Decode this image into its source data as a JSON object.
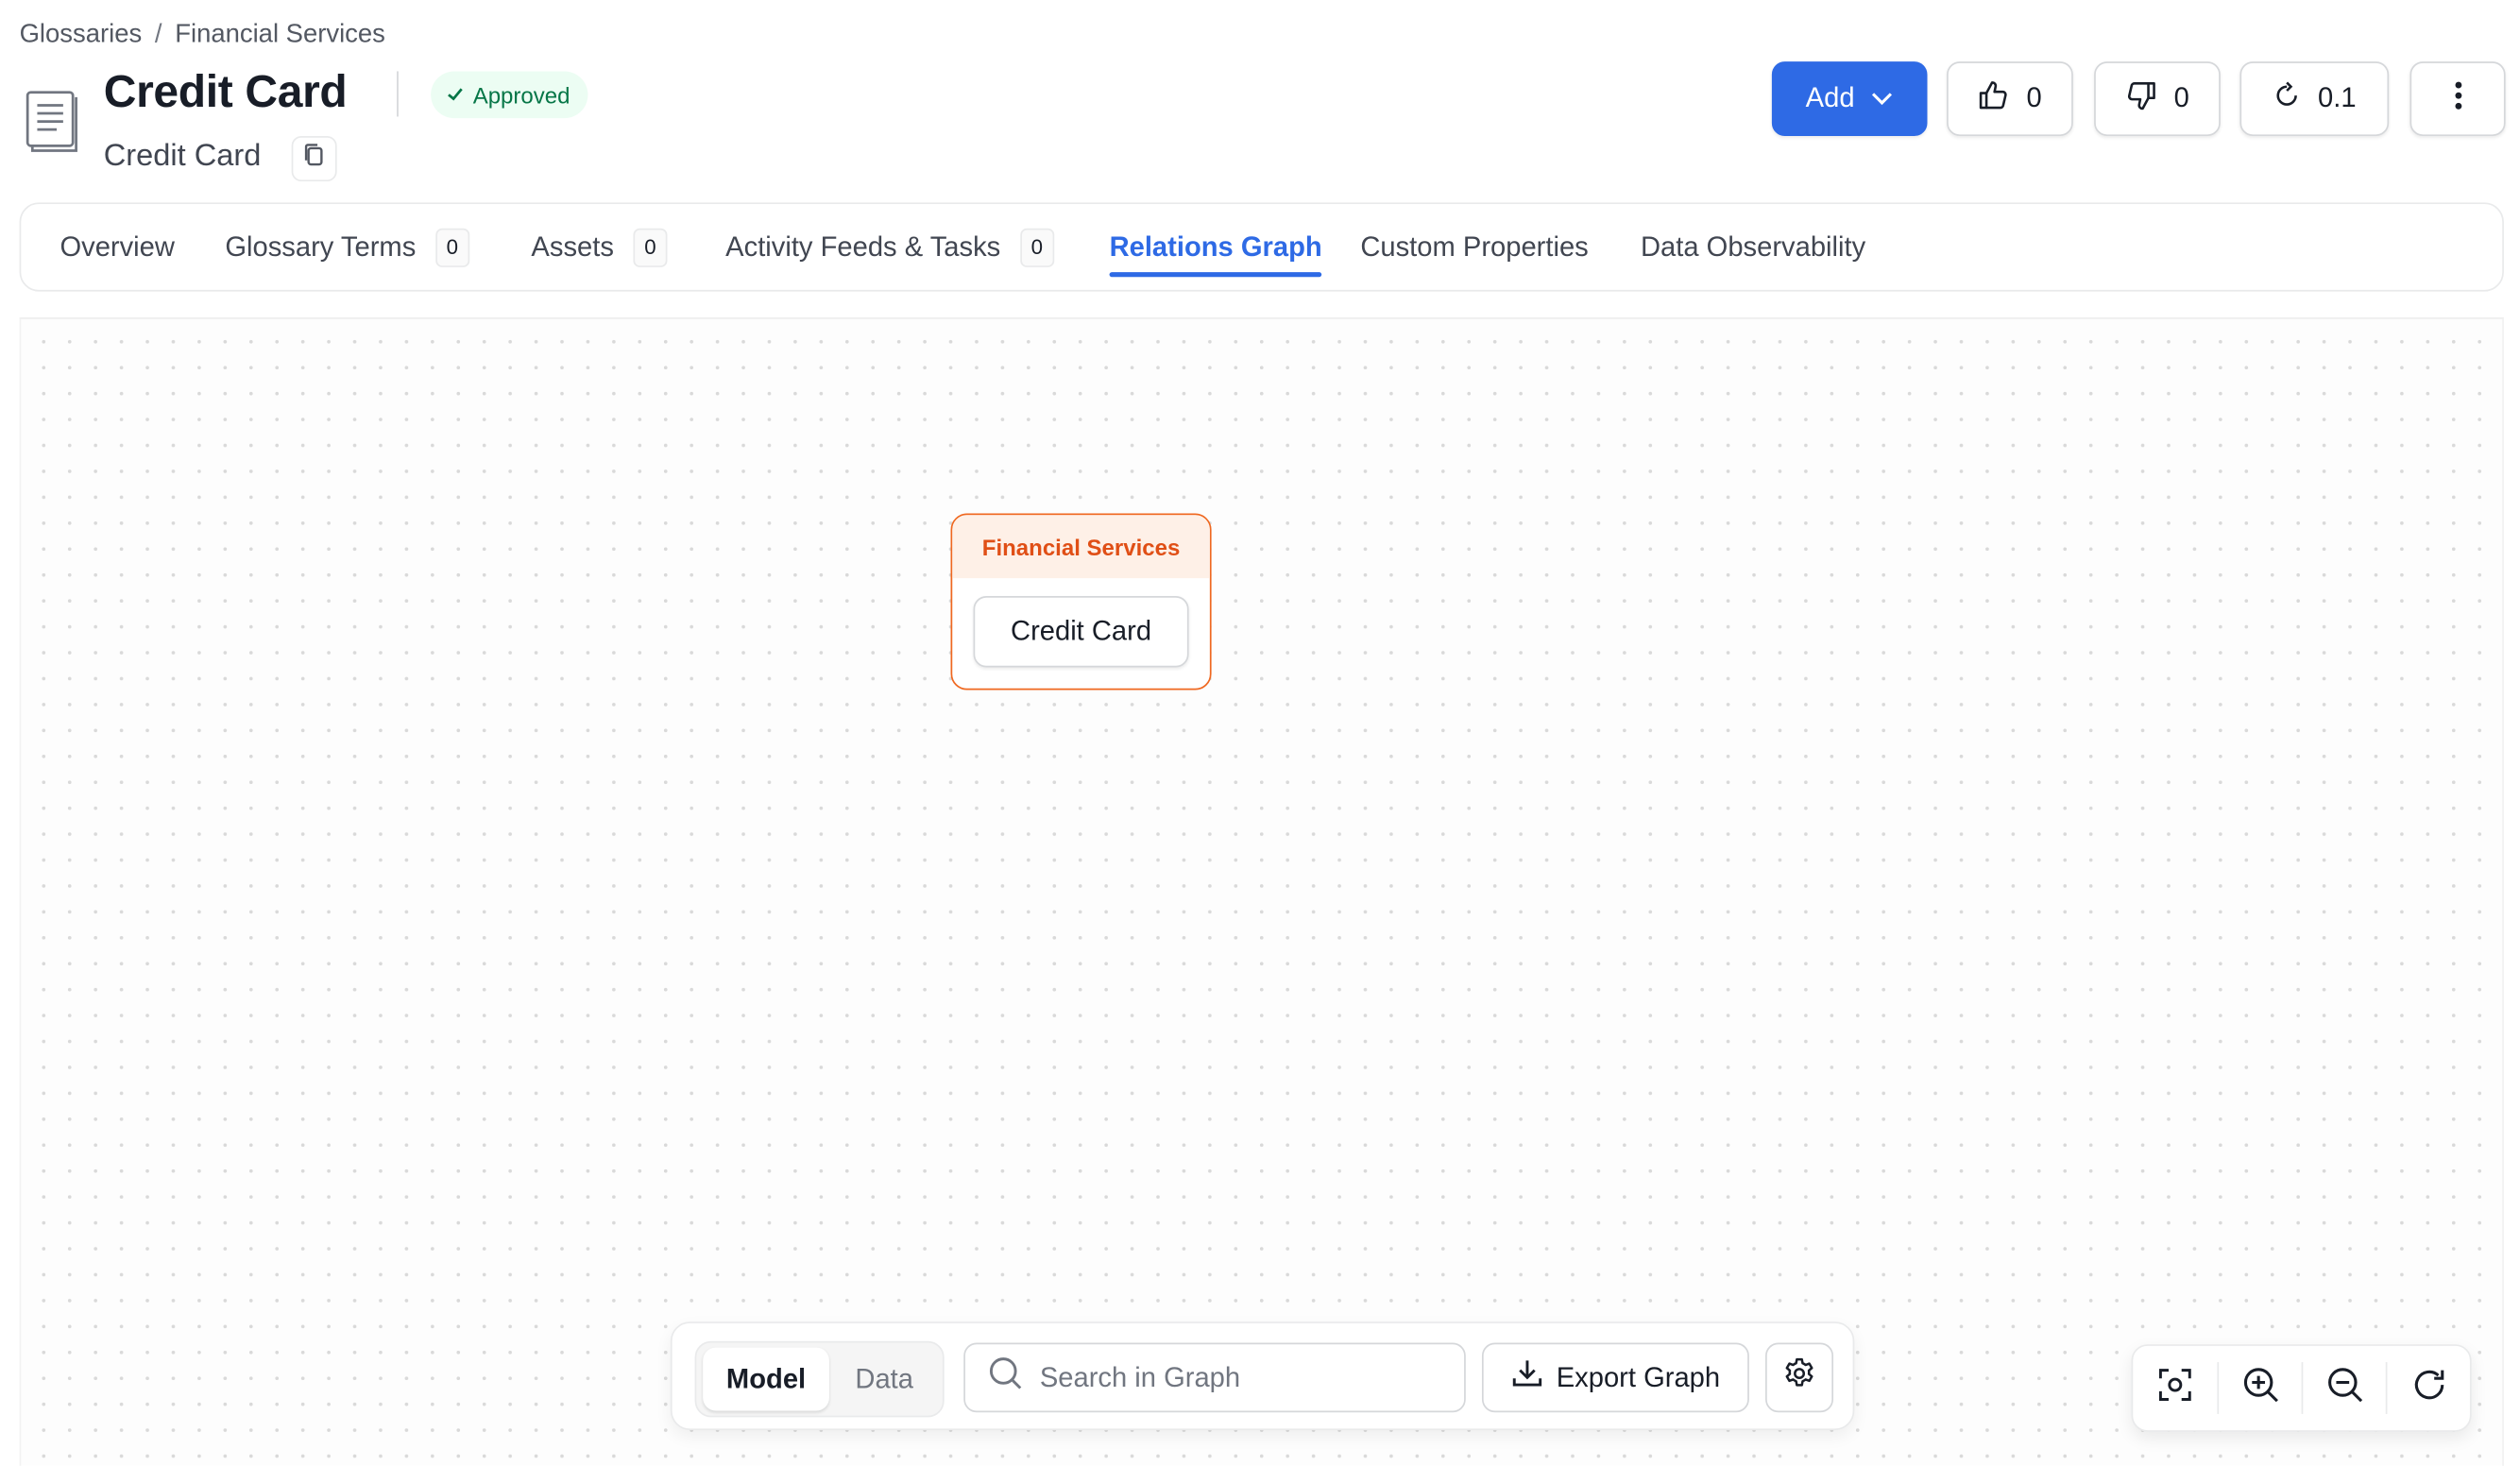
{
  "breadcrumb": {
    "items": [
      "Glossaries",
      "Financial Services"
    ],
    "separator": "/"
  },
  "header": {
    "title": "Credit Card",
    "status": "Approved",
    "display_name": "Credit Card"
  },
  "actions": {
    "add_label": "Add",
    "likes": "0",
    "dislikes": "0",
    "version": "0.1"
  },
  "tabs": [
    {
      "label": "Overview"
    },
    {
      "label": "Glossary Terms",
      "count": "0"
    },
    {
      "label": "Assets",
      "count": "0"
    },
    {
      "label": "Activity Feeds & Tasks",
      "count": "0"
    },
    {
      "label": "Relations Graph",
      "active": true
    },
    {
      "label": "Custom Properties"
    },
    {
      "label": "Data Observability"
    }
  ],
  "graph": {
    "group_label": "Financial Services",
    "term_label": "Credit Card"
  },
  "graph_toolbar": {
    "mode_model": "Model",
    "mode_data": "Data",
    "selected_mode": "Model",
    "search_placeholder": "Search in Graph",
    "export_label": "Export Graph"
  },
  "zoom_controls": {
    "icons": [
      "fit-view-icon",
      "zoom-in-icon",
      "zoom-out-icon",
      "refresh-icon"
    ]
  },
  "colors": {
    "accent": "#2e6ae5",
    "status_bg": "#ecfdf3",
    "status_text": "#067647",
    "group_border": "#ef6820",
    "group_header_bg": "#fef0e7",
    "group_header_text": "#e04f16"
  }
}
